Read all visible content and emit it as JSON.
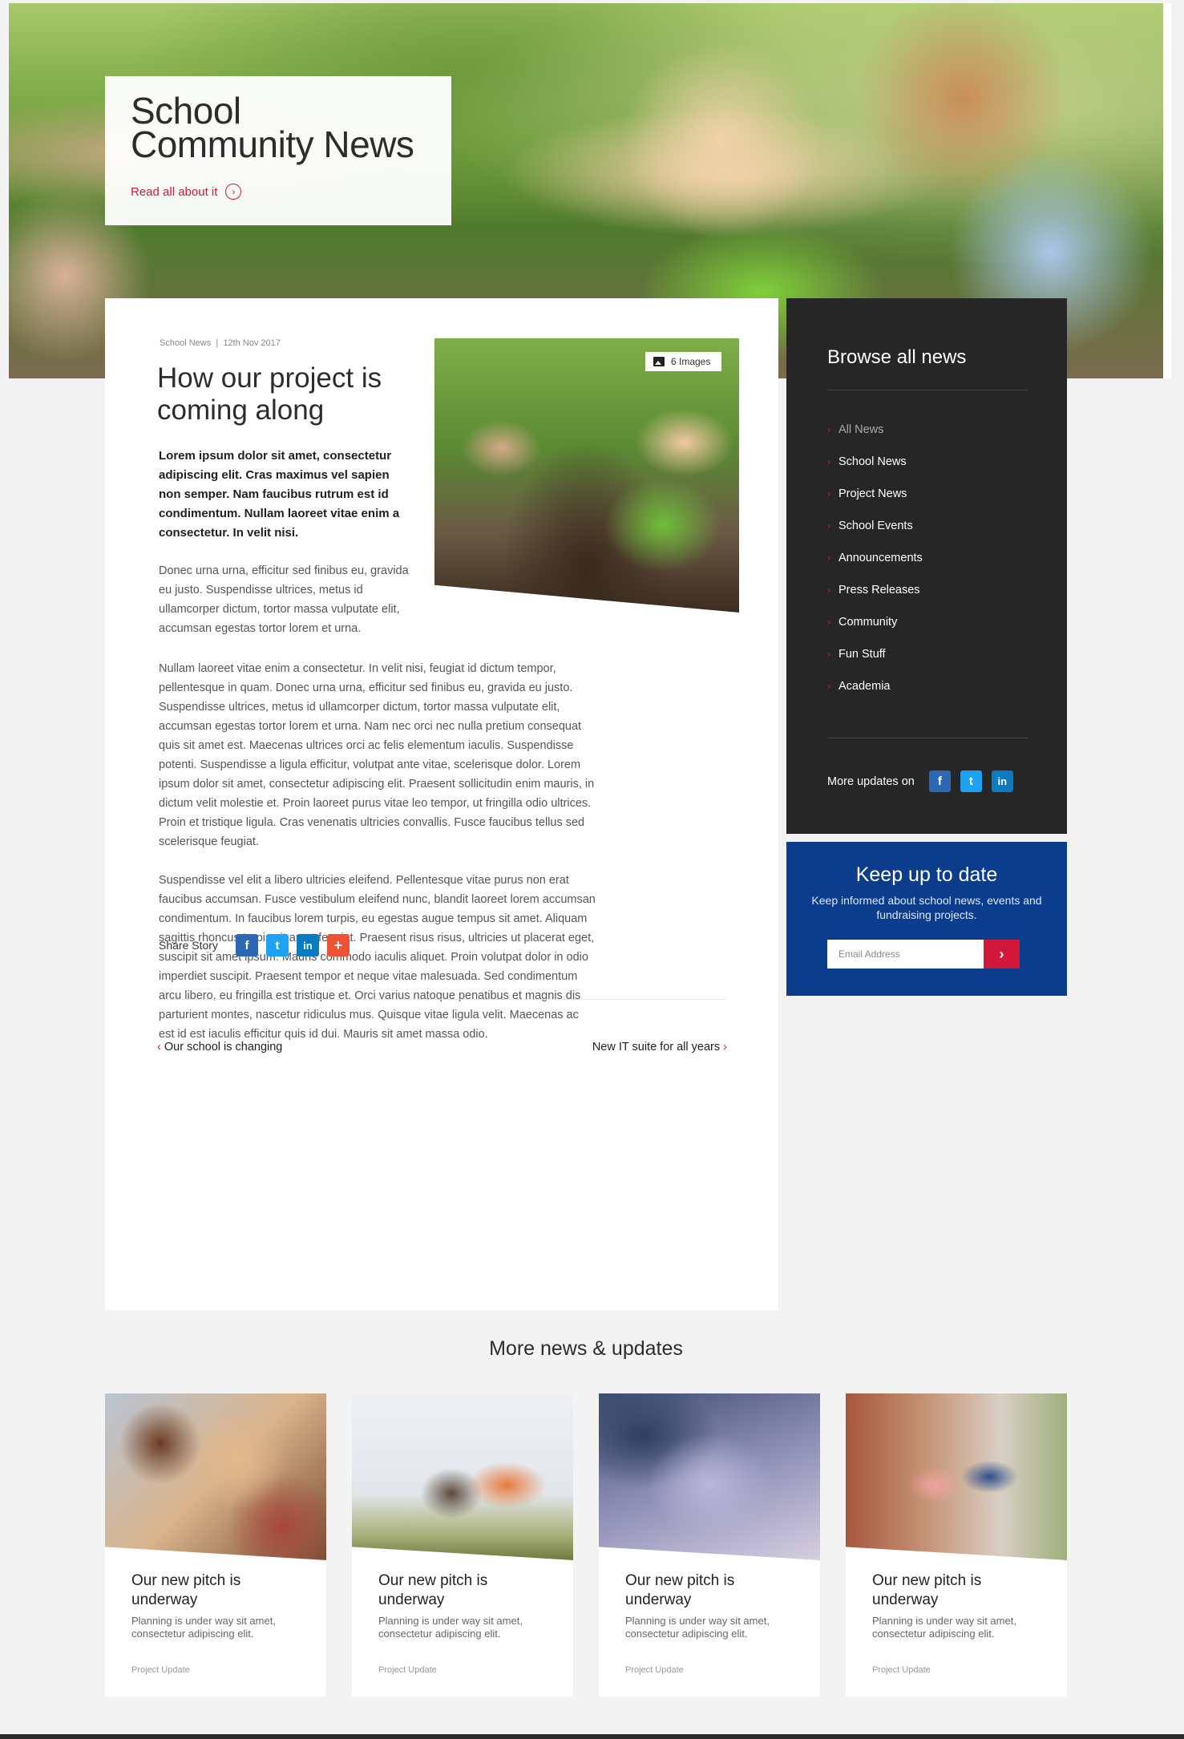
{
  "hero": {
    "title": "School Community News",
    "link": "Read all about it"
  },
  "article": {
    "category": "School News",
    "date": "12th Nov 2017",
    "title": "How our project is coming along",
    "image_badge": "6 Images",
    "lead": "Lorem ipsum dolor sit amet, consectetur adipiscing elit. Cras maximus vel sapien non semper. Nam faucibus rutrum est id condimentum. Nullam laoreet vitae enim a consectetur. In velit nisi.",
    "p1": "Donec urna urna, efficitur sed finibus eu, gravida eu justo. Suspendisse ultrices, metus id ullamcorper dictum, tortor massa vulputate elit, accumsan egestas tortor lorem et urna.",
    "p2": "Nullam laoreet vitae enim a consectetur. In velit nisi, feugiat id dictum tempor, pellentesque in quam. Donec urna urna, efficitur sed finibus eu, gravida eu justo. Suspendisse ultrices, metus id ullamcorper dictum, tortor massa vulputate elit, accumsan egestas tortor lorem et urna. Nam nec orci nec nulla pretium consequat quis sit amet est. Maecenas ultrices orci ac felis elementum iaculis. Suspendisse potenti. Suspendisse a ligula efficitur, volutpat ante vitae, scelerisque dolor. Lorem ipsum dolor sit amet, consectetur adipiscing elit. Praesent sollicitudin enim mauris, in dictum velit molestie et. Proin laoreet purus vitae leo tempor, ut fringilla odio ultrices. Proin et tristique ligula. Cras venenatis ultricies convallis. Fusce faucibus tellus sed scelerisque feugiat.",
    "p3": "Suspendisse vel elit a libero ultricies eleifend. Pellentesque vitae purus non erat faucibus accumsan. Fusce vestibulum eleifend nunc, blandit laoreet lorem accumsan condimentum. In faucibus lorem turpis, eu egestas augue tempus sit amet. Aliquam sagittis rhoncus turpis sit amet feugiat. Praesent risus risus, ultricies ut placerat eget, suscipit sit amet ipsum. Mauris commodo iaculis aliquet. Proin volutpat dolor in odio imperdiet suscipit. Praesent tempor et neque vitae malesuada. Sed condimentum arcu libero, eu fringilla est tristique et. Orci varius natoque penatibus et magnis dis parturient montes, nascetur ridiculus mus. Quisque vitae ligula velit. Maecenas ac est id est iaculis efficitur quis id dui. Mauris sit amet massa odio.",
    "share_label": "Share Story",
    "prev": "Our school is changing",
    "next": "New IT suite for all years"
  },
  "sidebar": {
    "title": "Browse all news",
    "items": [
      {
        "label": "All News"
      },
      {
        "label": "School News"
      },
      {
        "label": "Project News"
      },
      {
        "label": "School Events"
      },
      {
        "label": "Announcements"
      },
      {
        "label": "Press Releases"
      },
      {
        "label": "Community"
      },
      {
        "label": "Fun Stuff"
      },
      {
        "label": "Academia"
      }
    ],
    "updates_label": "More updates on"
  },
  "newsletter": {
    "title": "Keep up to date",
    "text": "Keep informed about school news, events and fundraising projects.",
    "placeholder": "Email Address"
  },
  "more": {
    "title": "More news & updates",
    "cards": [
      {
        "title": "Our new pitch is underway",
        "text": "Planning is under way sit amet, consectetur adipiscing elit.",
        "tag": "Project Update"
      },
      {
        "title": "Our new pitch is underway",
        "text": "Planning is under way sit amet, consectetur adipiscing elit.",
        "tag": "Project Update"
      },
      {
        "title": "Our new pitch is underway",
        "text": "Planning is under way sit amet, consectetur adipiscing elit.",
        "tag": "Project Update"
      },
      {
        "title": "Our new pitch is underway",
        "text": "Planning is under way sit amet, consectetur adipiscing elit.",
        "tag": "Project Update"
      }
    ]
  },
  "social": {
    "facebook": "f",
    "twitter": "t",
    "linkedin": "in",
    "plus": "+"
  },
  "colors": {
    "accent": "#d3173a",
    "sidebar_bg": "#262626",
    "newsletter_bg": "#0b3d8c"
  }
}
